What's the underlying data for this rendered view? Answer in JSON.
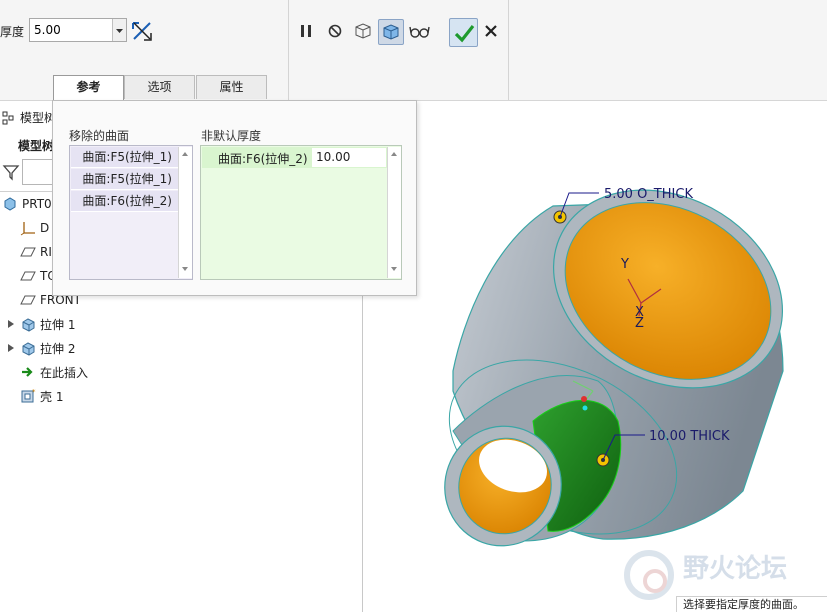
{
  "dashboard": {
    "thickness_label": "厚度",
    "thickness_value": "5.00",
    "tabs": [
      {
        "label": "参考",
        "active": true
      },
      {
        "label": "选项",
        "active": false
      },
      {
        "label": "属性",
        "active": false
      }
    ]
  },
  "ref_panel": {
    "removed_surfaces_title": "移除的曲面",
    "removed_surfaces": [
      "曲面:F5(拉伸_1)",
      "曲面:F5(拉伸_1)",
      "曲面:F6(拉伸_2)"
    ],
    "non_default_thickness_title": "非默认厚度",
    "non_default_rows": [
      {
        "surface": "曲面:F6(拉伸_2)",
        "value": "10.00"
      }
    ]
  },
  "model_tree": {
    "header_partial": "模型树",
    "sub_header_partial": "模型树",
    "items": [
      {
        "label": "PRT0",
        "icon": "part-icon"
      },
      {
        "label": "D",
        "icon": "csys-icon"
      },
      {
        "label": "RI",
        "icon": "datum-plane-icon"
      },
      {
        "label": "TO",
        "icon": "datum-plane-icon"
      },
      {
        "label": "FRONT",
        "icon": "datum-plane-icon"
      },
      {
        "label": "拉伸 1",
        "icon": "extrude-icon"
      },
      {
        "label": "拉伸 2",
        "icon": "extrude-icon"
      },
      {
        "label": "在此插入",
        "icon": "insert-arrow-icon"
      },
      {
        "label": "壳 1",
        "icon": "shell-icon"
      }
    ]
  },
  "viewport": {
    "annot_top": "5.00 O_THICK",
    "annot_side": "10.00 THICK",
    "axis_y": "Y",
    "axis_x": "X",
    "axis_z": "Z",
    "watermark": "野火论坛"
  },
  "status": {
    "message": "选择要指定厚度的曲面。"
  },
  "colors": {
    "inner_surface": "#f5a000",
    "body": "#a9b2bb",
    "selected_surface": "#1f8a1f",
    "accent_green": "#2a9d2a"
  }
}
